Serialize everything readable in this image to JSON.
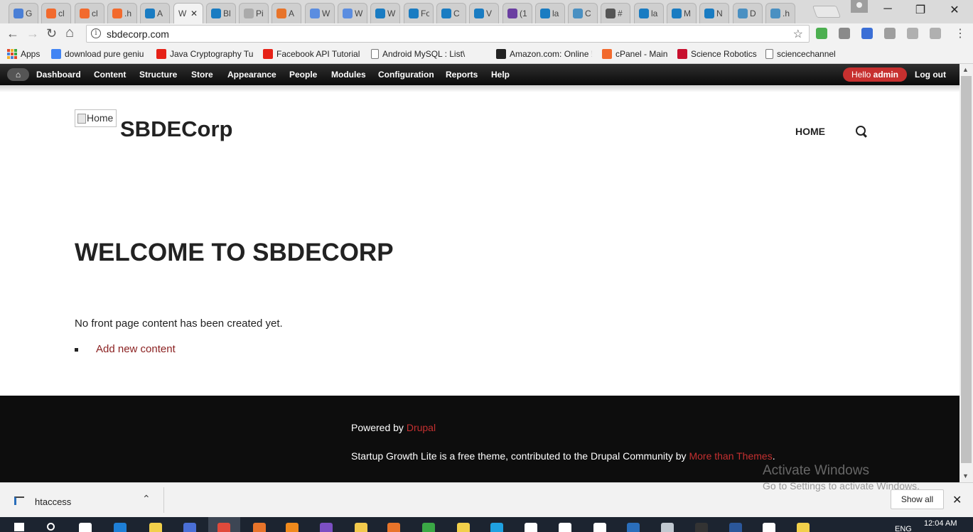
{
  "browser": {
    "tabs": [
      {
        "label": "G",
        "color": "#4a7fd6"
      },
      {
        "label": "cl",
        "color": "#f26a2d"
      },
      {
        "label": "cl",
        "color": "#f26a2d"
      },
      {
        "label": ".h",
        "color": "#f26a2d"
      },
      {
        "label": "A",
        "color": "#1a7cc2"
      },
      {
        "label": "W",
        "color": "#ffffff"
      },
      {
        "label": "Bl",
        "color": "#1a7cc2"
      },
      {
        "label": "Pi",
        "color": "#aaaaaa"
      },
      {
        "label": "A",
        "color": "#e8742a"
      },
      {
        "label": "W",
        "color": "#5b8de0"
      },
      {
        "label": "W",
        "color": "#5b8de0"
      },
      {
        "label": "W",
        "color": "#1a7cc2"
      },
      {
        "label": "Fo",
        "color": "#1a7cc2"
      },
      {
        "label": "C",
        "color": "#1a7cc2"
      },
      {
        "label": "V",
        "color": "#1a7cc2"
      },
      {
        "label": "(1",
        "color": "#6a3ea1"
      },
      {
        "label": "la",
        "color": "#1a7cc2"
      },
      {
        "label": "C",
        "color": "#4a90c2"
      },
      {
        "label": "#",
        "color": "#555555"
      },
      {
        "label": "la",
        "color": "#1a7cc2"
      },
      {
        "label": "M",
        "color": "#1a7cc2"
      },
      {
        "label": "N",
        "color": "#1a7cc2"
      },
      {
        "label": "D",
        "color": "#4a90c2"
      },
      {
        "label": ".h",
        "color": "#4a90c2"
      }
    ],
    "active_tab_close": "✕",
    "window_controls": {
      "minimize": "─",
      "maximize": "❐",
      "close": "✕"
    },
    "address": "sbdecorp.com",
    "info_glyph": "i",
    "star_glyph": "☆",
    "menu_glyph": "⋮",
    "nav": {
      "back": "←",
      "forward": "→",
      "reload": "↻",
      "home": "⌂"
    },
    "extensions": [
      {
        "name": "m-extension-icon",
        "color": "#4caf50"
      },
      {
        "name": "cube-extension-icon",
        "color": "#8a8a8a"
      },
      {
        "name": "dots-extension-icon",
        "color": "#3b6fd6"
      },
      {
        "name": "d-extension-icon",
        "color": "#9e9e9e"
      },
      {
        "name": "box-extension-icon",
        "color": "#b0b0b0"
      },
      {
        "name": "pdf-extension-icon",
        "color": "#b0b0b0"
      }
    ]
  },
  "bookmarks": [
    {
      "label": "Apps",
      "icon": "apps-grid-icon",
      "color": "#e0492b"
    },
    {
      "label": "download pure geniu",
      "icon": "google-icon",
      "color": "#4285f4"
    },
    {
      "label": "Java Cryptography Tu",
      "icon": "youtube-icon",
      "color": "#e62117"
    },
    {
      "label": "Facebook API Tutorial",
      "icon": "youtube-icon",
      "color": "#e62117"
    },
    {
      "label": "Android MySQL : List\\",
      "icon": "page-icon",
      "color": "#ffffff"
    },
    {
      "label": "Amazon.com: Online !",
      "icon": "amazon-icon",
      "color": "#222222"
    },
    {
      "label": "cPanel - Main",
      "icon": "cpanel-icon",
      "color": "#f26a2d"
    },
    {
      "label": "Science Robotics",
      "icon": "science-icon",
      "color": "#c8102e"
    },
    {
      "label": "sciencechannel",
      "icon": "page-icon",
      "color": "#ffffff"
    }
  ],
  "admin": {
    "home_glyph": "⌂",
    "items": [
      "Dashboard",
      "Content",
      "Structure",
      "Store",
      "Appearance",
      "People",
      "Modules",
      "Configuration",
      "Reports",
      "Help"
    ],
    "hello_prefix": "Hello",
    "hello_user": "admin",
    "logout": "Log out"
  },
  "site": {
    "logo_alt": "Home",
    "name": "SBDECorp",
    "nav_home": "HOME",
    "title": "WELCOME TO SBDECORP",
    "empty_message": "No front page content has been created yet.",
    "add_link": "Add new content"
  },
  "footer": {
    "powered_prefix": "Powered by",
    "powered_link": "Drupal",
    "credits_prefix": "Startup Growth Lite is a free theme, contributed to the Drupal Community by",
    "credits_link": "More than Themes",
    "credits_suffix": "."
  },
  "watermark": {
    "title": "Activate Windows",
    "subtitle": "Go to Settings to activate Windows."
  },
  "download": {
    "filename": "htaccess",
    "chevron": "⌃",
    "show_all": "Show all",
    "close": "✕"
  },
  "taskbar": {
    "time": "12:04 AM",
    "lang": "ENG",
    "icons": [
      {
        "name": "start-icon",
        "color": "#ffffff"
      },
      {
        "name": "search-icon",
        "color": "#ffffff"
      },
      {
        "name": "task-view-icon",
        "color": "#ffffff"
      },
      {
        "name": "edge-icon",
        "color": "#1e7fd6"
      },
      {
        "name": "bulb-icon",
        "color": "#f2d04a"
      },
      {
        "name": "ninja-icon",
        "color": "#4a6fd6"
      },
      {
        "name": "chrome-icon",
        "color": "#e04a3b"
      },
      {
        "name": "filezilla-icon",
        "color": "#e8742a"
      },
      {
        "name": "vlc-icon",
        "color": "#f08a1c"
      },
      {
        "name": "vs-icon",
        "color": "#7b4fc2"
      },
      {
        "name": "folder-icon",
        "color": "#f2c94c"
      },
      {
        "name": "firefox-icon",
        "color": "#e8742a"
      },
      {
        "name": "globe-icon",
        "color": "#3aa845"
      },
      {
        "name": "file-icon",
        "color": "#f2d04a"
      },
      {
        "name": "skype-icon",
        "color": "#1fa1e0"
      },
      {
        "name": "at-icon",
        "color": "#ffffff"
      },
      {
        "name": "mail-icon",
        "color": "#ffffff"
      },
      {
        "name": "calc-icon",
        "color": "#ffffff"
      },
      {
        "name": "app-icon",
        "color": "#2a6ebb"
      },
      {
        "name": "tool-icon",
        "color": "#c0c8d0"
      },
      {
        "name": "cmd-icon",
        "color": "#333333"
      },
      {
        "name": "word-icon",
        "color": "#2b579a"
      },
      {
        "name": "photos-icon",
        "color": "#ffffff"
      },
      {
        "name": "notes-icon",
        "color": "#f2d04a"
      }
    ]
  },
  "colors": {
    "accent_red": "#c7302f",
    "link_red": "#8a1f1f",
    "footer_bg": "#0d0d0d"
  }
}
